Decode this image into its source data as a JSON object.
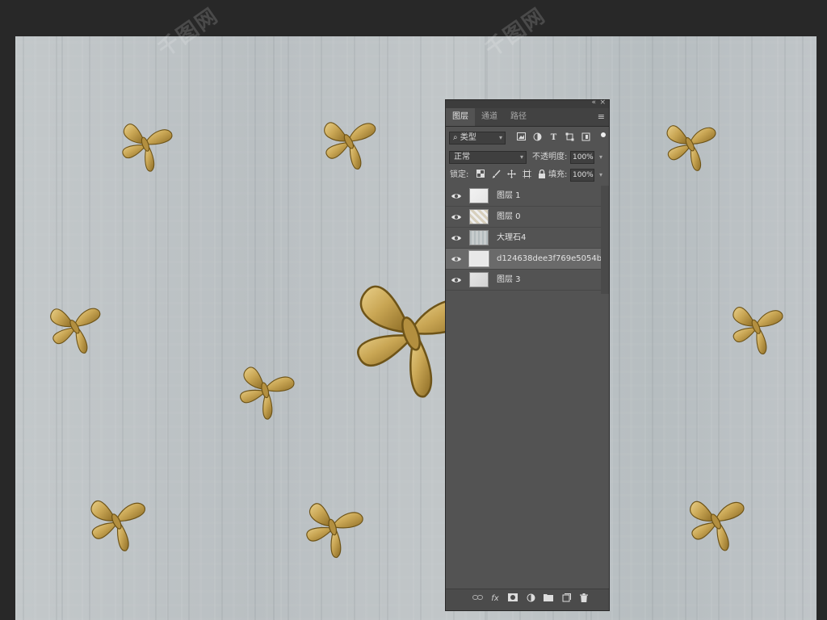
{
  "watermark": "千图网",
  "panel": {
    "collapse_glyph": "«",
    "close_glyph": "×",
    "tabs": [
      {
        "label": "图层",
        "active": true
      },
      {
        "label": "通道",
        "active": false
      },
      {
        "label": "路径",
        "active": false
      }
    ],
    "filter": {
      "kind_label": "类型",
      "search_glyph": "⌕"
    },
    "blend_mode": "正常",
    "opacity_label": "不透明度:",
    "opacity_value": "100%",
    "lock_label": "锁定:",
    "fill_label": "填充:",
    "fill_value": "100%",
    "layers": [
      {
        "name": "图层 1",
        "visible": true,
        "selected": false
      },
      {
        "name": "图层 0",
        "visible": true,
        "selected": false
      },
      {
        "name": "大理石4",
        "visible": true,
        "selected": false
      },
      {
        "name": "d124638dee3f769e5054b...",
        "visible": true,
        "selected": true
      },
      {
        "name": "图层 3",
        "visible": true,
        "selected": false
      }
    ],
    "bottom_fx_label": "fx"
  },
  "colors": {
    "background": "#282828",
    "panel": "#535353",
    "gold": "#c9a654",
    "marble": "#bec4c7"
  }
}
